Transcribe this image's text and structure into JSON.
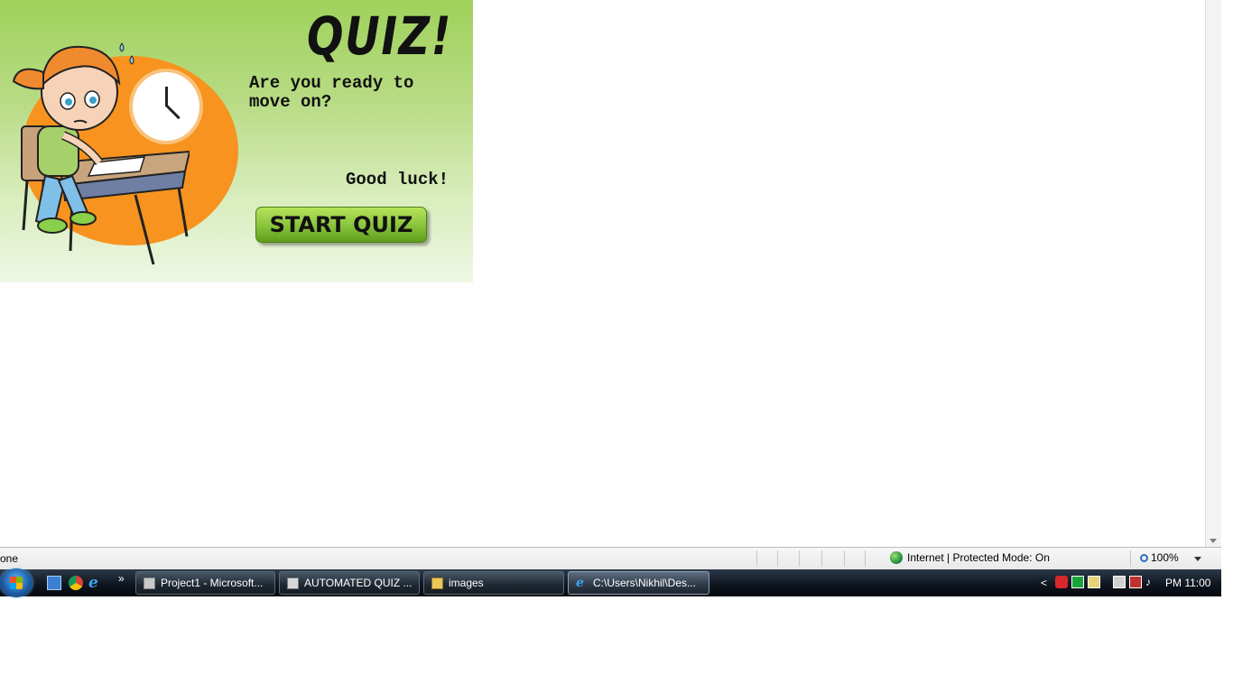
{
  "banner": {
    "title": "QUIZ!",
    "prompt": "Are you ready to move on?",
    "luck": "Good luck!",
    "start_button": "START QUIZ"
  },
  "statusbar": {
    "left_text": "one",
    "zone": "Internet | Protected Mode: On",
    "zoom": "100%"
  },
  "taskbar": {
    "buttons": [
      {
        "label": "Project1 - Microsoft..."
      },
      {
        "label": "AUTOMATED QUIZ ..."
      },
      {
        "label": "images"
      },
      {
        "label": "C:\\Users\\Nikhil\\Des..."
      }
    ],
    "quick_launch_more": "»",
    "tray_expand": "<",
    "time": "PM 11:00"
  },
  "colors": {
    "banner_green": "#9fd15b",
    "orange_disc": "#f7931e",
    "button_green": "#8cc63f",
    "taskbar_dark": "#0f1620"
  },
  "icons": [
    "start-orb",
    "show-desktop-icon",
    "chrome-icon",
    "ie-icon",
    "vb-project-icon",
    "app-icon",
    "folder-icon",
    "ie-icon",
    "acrobat-icon",
    "status-icon",
    "network-icon",
    "volume-icon"
  ]
}
